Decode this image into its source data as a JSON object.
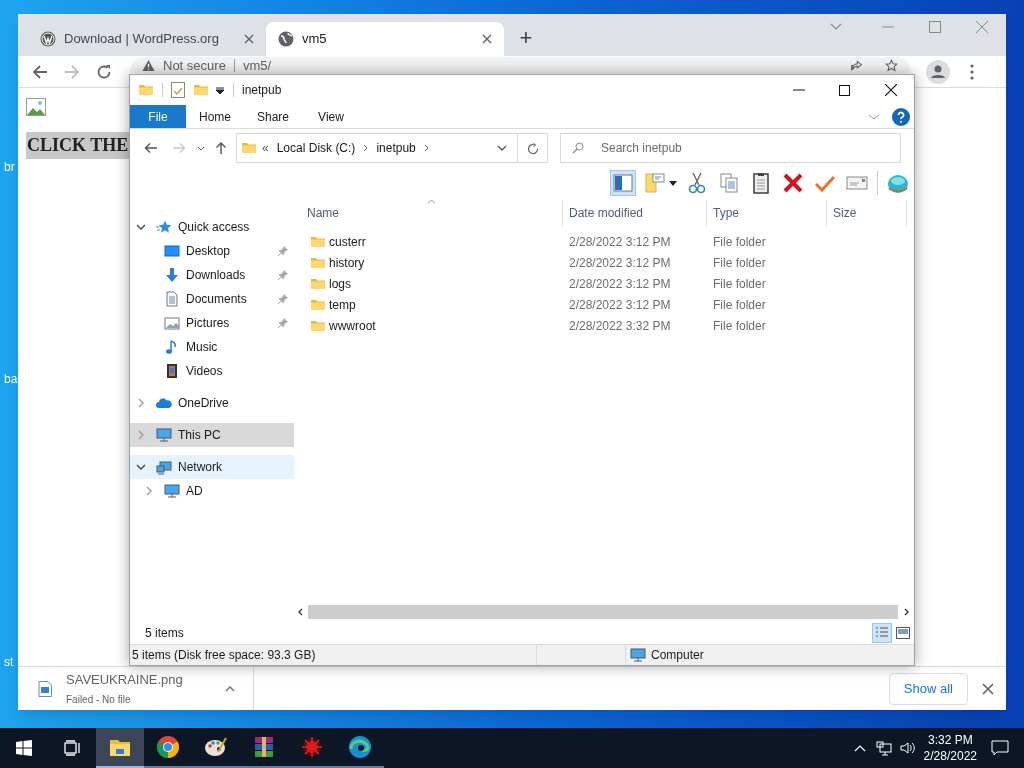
{
  "desktop": {
    "labels": [
      "br",
      "ba",
      "st"
    ]
  },
  "browser": {
    "tabs": [
      {
        "title": "Download | WordPress.org",
        "selected": false,
        "kind": "wordpress"
      },
      {
        "title": "vm5",
        "selected": true,
        "kind": "globe"
      }
    ],
    "new_tab": "+",
    "address": {
      "security": "Not secure",
      "url": "vm5/"
    },
    "page_heading": "CLICK THE",
    "download": {
      "file": "SAVEUKRAINE.png",
      "status": "Failed - No file"
    },
    "show_all": "Show all"
  },
  "explorer": {
    "title": "inetpub",
    "ribbon_tabs": [
      {
        "label": "File",
        "selected": true
      },
      {
        "label": "Home",
        "selected": false
      },
      {
        "label": "Share",
        "selected": false
      },
      {
        "label": "View",
        "selected": false
      }
    ],
    "breadcrumb": {
      "overflow": "«",
      "parts": [
        "Local Disk (C:)",
        "inetpub"
      ]
    },
    "search": {
      "placeholder": "Search inetpub"
    },
    "sidebar": {
      "items": [
        {
          "label": "Quick access",
          "kind": "star",
          "expanded": true,
          "selected": false,
          "hovered": false,
          "children": [
            {
              "label": "Desktop",
              "kind": "desktop",
              "pinned": true,
              "selected": false,
              "hovered": false
            },
            {
              "label": "Downloads",
              "kind": "download",
              "pinned": true,
              "selected": false,
              "hovered": false
            },
            {
              "label": "Documents",
              "kind": "document",
              "pinned": true,
              "selected": false,
              "hovered": false
            },
            {
              "label": "Pictures",
              "kind": "picture",
              "pinned": true,
              "selected": false,
              "hovered": false
            },
            {
              "label": "Music",
              "kind": "music",
              "pinned": false,
              "selected": false,
              "hovered": false
            },
            {
              "label": "Videos",
              "kind": "video",
              "pinned": false,
              "selected": false,
              "hovered": false
            }
          ]
        },
        {
          "label": "OneDrive",
          "kind": "cloud",
          "expanded": false,
          "selected": false,
          "hovered": false
        },
        {
          "label": "This PC",
          "kind": "pc",
          "expanded": false,
          "selected": true,
          "hovered": false
        },
        {
          "label": "Network",
          "kind": "network",
          "expanded": true,
          "selected": false,
          "hovered": true,
          "children": [
            {
              "label": "AD",
              "kind": "pc",
              "expanded": false,
              "selected": false,
              "hovered": false
            }
          ]
        }
      ]
    },
    "table": {
      "columns": [
        "Name",
        "Date modified",
        "Type",
        "Size"
      ],
      "rows": [
        {
          "name": "custerr",
          "date_modified": "2/28/2022 3:12 PM",
          "type": "File folder"
        },
        {
          "name": "history",
          "date_modified": "2/28/2022 3:12 PM",
          "type": "File folder"
        },
        {
          "name": "logs",
          "date_modified": "2/28/2022 3:12 PM",
          "type": "File folder"
        },
        {
          "name": "temp",
          "date_modified": "2/28/2022 3:12 PM",
          "type": "File folder"
        },
        {
          "name": "wwwroot",
          "date_modified": "2/28/2022 3:32 PM",
          "type": "File folder"
        }
      ]
    },
    "item_count": "5 items",
    "status_bar": {
      "text": "5 items (Disk free space: 93.3 GB)",
      "location": "Computer"
    }
  },
  "taskbar": {
    "apps": [
      {
        "kind": "explorer",
        "selected": true
      },
      {
        "kind": "chrome",
        "selected": false
      },
      {
        "kind": "paint",
        "selected": false
      },
      {
        "kind": "archive",
        "selected": false
      },
      {
        "kind": "ornament",
        "selected": false
      },
      {
        "kind": "edge",
        "selected": false
      }
    ],
    "time": "3:32 PM",
    "date": "2/28/2022"
  }
}
